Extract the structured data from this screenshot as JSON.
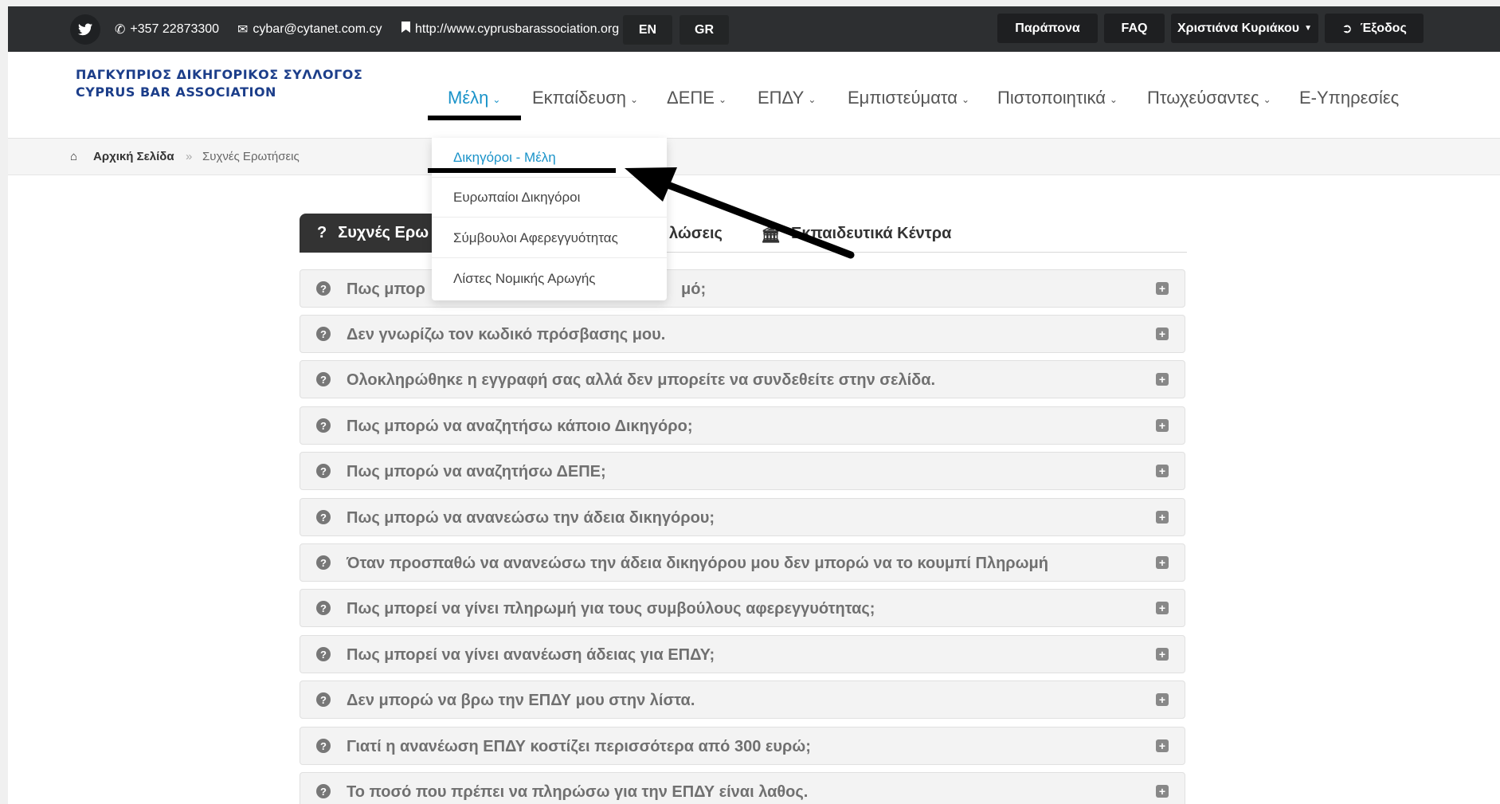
{
  "topbar": {
    "phone": "+357 22873300",
    "email": "cybar@cytanet.com.cy",
    "website": "http://www.cyprusbarassociation.org",
    "lang_en": "EN",
    "lang_gr": "GR",
    "complaints": "Παράπονα",
    "faq": "FAQ",
    "user": "Χριστιάνα Κυριάκου",
    "logout": "Έξοδος"
  },
  "logo": {
    "line1": "ΠΑΓΚΥΠΡΙΟΣ ΔΙΚΗΓΟΡΙΚΟΣ ΣΥΛΛΟΓΟΣ",
    "line2": "CYPRUS BAR ASSOCIATION"
  },
  "nav": {
    "items": [
      "Μέλη",
      "Εκπαίδευση",
      "ΔΕΠΕ",
      "ΕΠΔΥ",
      "Εμπιστεύματα",
      "Πιστοποιητικά",
      "Πτωχεύσαντες",
      "Ε-Υπηρεσίες"
    ]
  },
  "dropdown": {
    "items": [
      "Δικηγόροι - Μέλη",
      "Ευρωπαίοι Δικηγόροι",
      "Σύμβουλοι Αφερεγγυότητας",
      "Λίστες Νομικής Αρωγής"
    ]
  },
  "breadcrumb": {
    "home": "Αρχική Σελίδα",
    "separator": "»",
    "current": "Συχνές Ερωτήσεις"
  },
  "tabs": {
    "faq": "Συχνές Ερω",
    "announcements": "λώσεις",
    "training_centers": "Εκπαιδευτικά Κέντρα"
  },
  "faq": {
    "items": [
      "Πως μπορ",
      "Δεν γνωρίζω τον κωδικό πρόσβασης μου.",
      "Ολοκληρώθηκε η εγγραφή σας αλλά δεν μπορείτε να συνδεθείτε στην σελίδα.",
      "Πως μπορώ να αναζητήσω κάποιο Δικηγόρο;",
      "Πως μπορώ να αναζητήσω ΔΕΠΕ;",
      "Πως μπορώ να ανανεώσω την άδεια δικηγόρου;",
      "Όταν προσπαθώ να ανανεώσω την άδεια δικηγόρου μου δεν μπορώ να το κουμπί Πληρωμή",
      "Πως μπορεί να γίνει πληρωμή για τους συμβούλους αφερεγγυότητας;",
      "Πως μπορεί να γίνει ανανέωση άδειας για ΕΠΔΥ;",
      "Δεν μπορώ να βρω την ΕΠΔΥ μου στην λίστα.",
      "Γιατί η ανανέωση ΕΠΔΥ κοστίζει περισσότερα από 300 ευρώ;",
      "Το ποσό που πρέπει να πληρώσω για την ΕΠΔΥ είναι λαθος."
    ],
    "first_item_tail": "μό;"
  },
  "colors": {
    "topbar": "#2d2f31",
    "accent": "#1a93c9",
    "logo": "#1c3e8a",
    "active_tab": "#333333"
  }
}
